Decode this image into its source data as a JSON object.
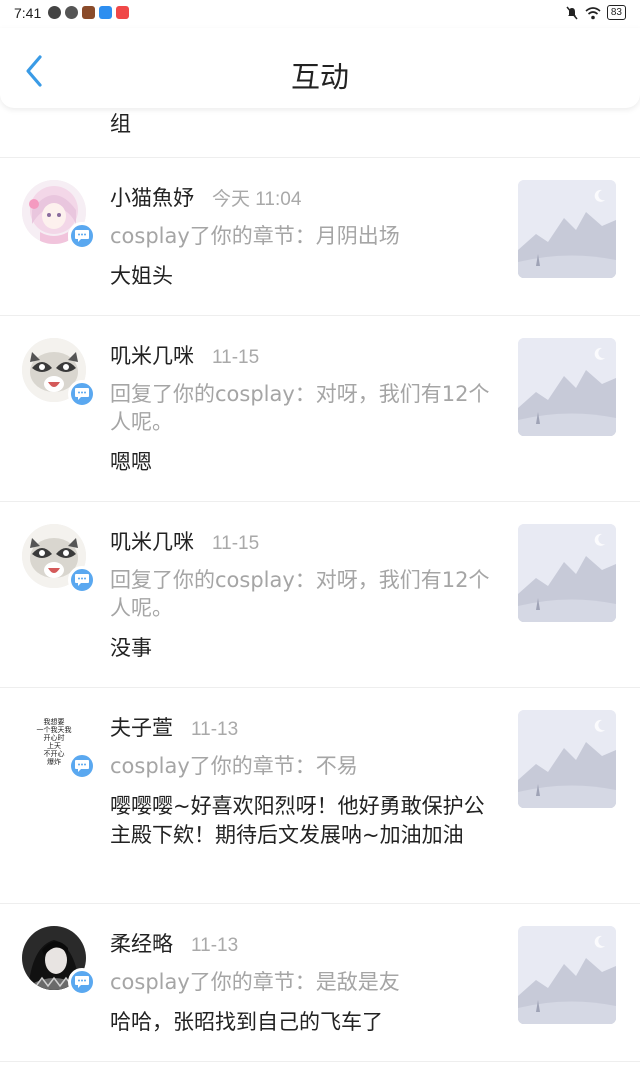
{
  "status_bar": {
    "time": "7:41",
    "battery": "83",
    "left_icons": [
      "wechat-icon",
      "settings-sync-icon",
      "game-app-icon",
      "cloud-app-icon",
      "red-app-icon"
    ],
    "right_icons": [
      "mute-icon",
      "wifi-icon",
      "battery-icon"
    ]
  },
  "header": {
    "title": "互动",
    "back_icon": "chevron-left-icon"
  },
  "feed": {
    "partial_comment": "组",
    "items": [
      {
        "name": "小猫魚妤",
        "time": "今天 11:04",
        "action": "cosplay了你的章节：月阴出场",
        "comment": "大姐头",
        "avatar": "anime-girl-avatar",
        "badge_icon": "comment-bubble-icon",
        "thumb_icon": "placeholder-image-icon"
      },
      {
        "name": "叽米几咪",
        "time": "11-15",
        "action": "回复了你的cosplay：对呀，我们有12个人呢。",
        "comment": "嗯嗯",
        "avatar": "raccoon-avatar",
        "badge_icon": "comment-bubble-icon",
        "thumb_icon": "placeholder-image-icon"
      },
      {
        "name": "叽米几咪",
        "time": "11-15",
        "action": "回复了你的cosplay：对呀，我们有12个人呢。",
        "comment": "没事",
        "avatar": "raccoon-avatar",
        "badge_icon": "comment-bubble-icon",
        "thumb_icon": "placeholder-image-icon"
      },
      {
        "name": "夫子萱",
        "time": "11-13",
        "action": "cosplay了你的章节：不易",
        "comment": "嘤嘤嘤~好喜欢阳烈呀！他好勇敢保护公主殿下欸！期待后文发展呐~加油加油",
        "avatar": "text-meme-avatar",
        "avatar_text": "我想要\n一个我天我\n开心时\n上天\n不开心\n爆炸",
        "badge_icon": "comment-bubble-icon",
        "thumb_icon": "placeholder-image-icon"
      },
      {
        "name": "柔经略",
        "time": "11-13",
        "action": "cosplay了你的章节：是敌是友",
        "comment": "哈哈，张昭找到自己的飞车了",
        "avatar": "dark-portrait-avatar",
        "badge_icon": "comment-bubble-icon",
        "thumb_icon": "placeholder-image-icon"
      }
    ]
  },
  "colors": {
    "accent": "#3a9be6",
    "badge": "#5aa8f0",
    "muted_text": "#a5a5a5",
    "divider": "#eeeeee"
  }
}
